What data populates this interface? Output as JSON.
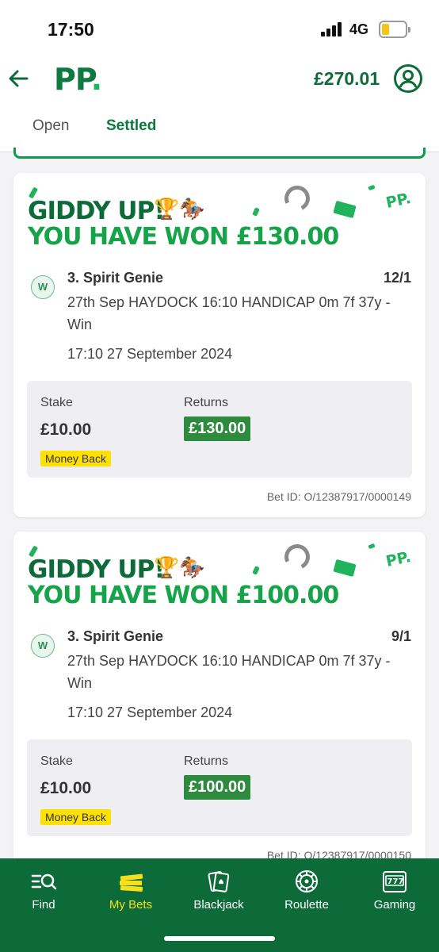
{
  "status_bar": {
    "time": "17:50",
    "network": "4G"
  },
  "header": {
    "logo": "PP",
    "balance": "£270.01",
    "back_icon": "arrow-left-icon",
    "account_icon": "user-circle-icon"
  },
  "tabs": [
    {
      "label": "Open",
      "active": false
    },
    {
      "label": "Settled",
      "active": true
    }
  ],
  "colors": {
    "brand_dark": "#0d6b3a",
    "brand_green": "#16a34a",
    "returns_bg": "#2e8b3e",
    "money_back_bg": "#fde100",
    "nav_active": "#f7e017"
  },
  "bets": [
    {
      "banner_line1": "GIDDY UP!",
      "banner_emoji": "🏆🏇",
      "banner_line2": "YOU HAVE WON £130.00",
      "banner_logo": "PP.",
      "result_badge": "W",
      "selection": "3. Spirit Genie",
      "odds": "12/1",
      "market": "27th Sep HAYDOCK 16:10 HANDICAP 0m 7f 37y - Win",
      "datetime": "17:10 27 September 2024",
      "stake_label": "Stake",
      "stake": "£10.00",
      "returns_label": "Returns",
      "returns": "£130.00",
      "promo_tag": "Money Back",
      "bet_id": "Bet ID: O/12387917/0000149"
    },
    {
      "banner_line1": "GIDDY UP!",
      "banner_emoji": "🏆🏇",
      "banner_line2": "YOU HAVE WON £100.00",
      "banner_logo": "PP.",
      "result_badge": "W",
      "selection": "3. Spirit Genie",
      "odds": "9/1",
      "market": "27th Sep HAYDOCK 16:10 HANDICAP 0m 7f 37y - Win",
      "datetime": "17:10 27 September 2024",
      "stake_label": "Stake",
      "stake": "£10.00",
      "returns_label": "Returns",
      "returns": "£100.00",
      "promo_tag": "Money Back",
      "bet_id": "Bet ID: O/12387917/0000150"
    }
  ],
  "bottom_nav": [
    {
      "label": "Find",
      "icon": "search-list-icon",
      "active": false
    },
    {
      "label": "My Bets",
      "icon": "bet-slips-icon",
      "active": true
    },
    {
      "label": "Blackjack",
      "icon": "playing-cards-icon",
      "active": false
    },
    {
      "label": "Roulette",
      "icon": "roulette-wheel-icon",
      "active": false
    },
    {
      "label": "Gaming",
      "icon": "slot-machine-icon",
      "active": false
    }
  ]
}
